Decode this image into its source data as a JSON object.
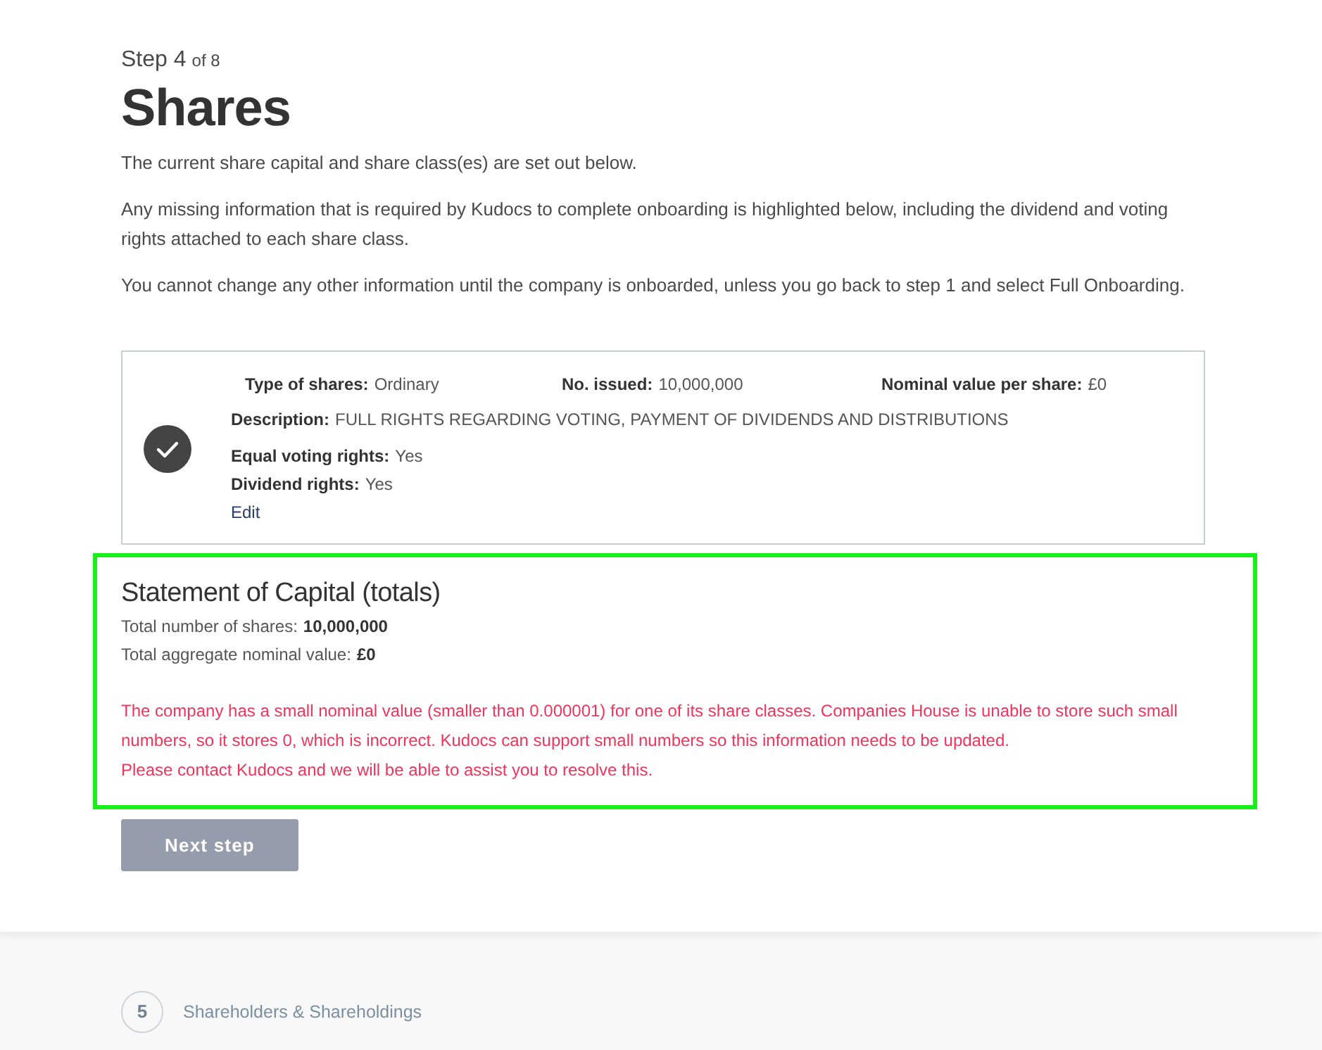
{
  "step": {
    "label": "Step 4",
    "total": "of 8"
  },
  "title": "Shares",
  "intro": [
    "The current share capital and share class(es) are set out below.",
    "Any missing information that is required by Kudocs to complete onboarding is highlighted below, including the dividend and voting rights attached to each share class.",
    "You cannot change any other information until the company is onboarded, unless you go back to step 1 and select Full Onboarding."
  ],
  "share_classes": [
    {
      "complete": true,
      "summary": [
        {
          "label": "Type of shares:",
          "value": "Ordinary"
        },
        {
          "label": "No. issued:",
          "value": "10,000,000"
        },
        {
          "label": "Nominal value per share:",
          "value": "£0"
        }
      ],
      "details": [
        {
          "label": "Description:",
          "value": "FULL RIGHTS REGARDING VOTING, PAYMENT OF DIVIDENDS AND DISTRIBUTIONS"
        },
        {
          "label": "Equal voting rights:",
          "value": "Yes"
        },
        {
          "label": "Dividend rights:",
          "value": "Yes"
        }
      ],
      "edit_link": "Edit"
    }
  ],
  "statement": {
    "highlighted": true,
    "title": "Statement of Capital (totals)",
    "totals": [
      {
        "label": "Total number of shares:",
        "value": "10,000,000"
      },
      {
        "label": "Total aggregate nominal value:",
        "value": "£0"
      }
    ],
    "errors": [
      "The company has a small nominal value (smaller than 0.000001) for one of its share classes. Companies House is unable to store such small numbers, so it stores 0, which is incorrect. Kudocs can support small numbers so this information needs to be updated.",
      "Please contact Kudocs and we will be able to assist you to resolve this."
    ]
  },
  "next_button": {
    "label": "Next step",
    "disabled": true
  },
  "upcoming_steps": [
    {
      "number": "5",
      "label": "Shareholders & Shareholdings"
    }
  ]
}
